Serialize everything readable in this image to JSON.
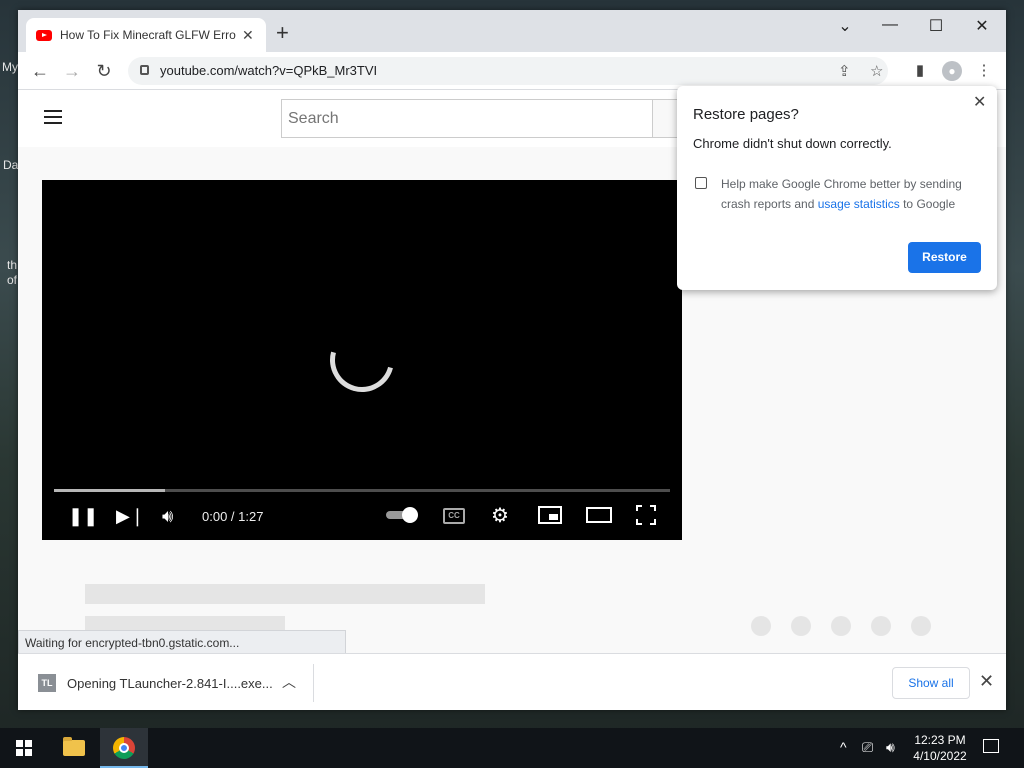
{
  "desktop": {
    "fragments": [
      "My",
      "Da",
      "th",
      "of"
    ]
  },
  "browser": {
    "tab_title": "How To Fix Minecraft GLFW Error",
    "tab_close": "✕",
    "new_tab": "+",
    "window_controls": {
      "tab_search": "⌄",
      "minimize": "—",
      "maximize": "☐",
      "close": "✕"
    },
    "nav": {
      "back": "←",
      "forward": "→",
      "reload": "↻"
    },
    "url": "youtube.com/watch?v=QPkB_Mr3TVI",
    "omnibox_icons": [
      "share-icon",
      "star-icon"
    ],
    "toolbar_icons": [
      "side-panel-icon",
      "profile-icon",
      "menu-icon"
    ]
  },
  "youtube": {
    "search_placeholder": "Search",
    "player": {
      "time": "0:00 / 1:27",
      "progress_fraction": 0.18,
      "controls": [
        "pause-icon",
        "next-icon",
        "volume-icon",
        "autoplay-toggle",
        "captions-icon",
        "settings-icon",
        "miniplayer-icon",
        "theater-icon",
        "fullscreen-icon"
      ]
    }
  },
  "status_bar": {
    "text": "Waiting for encrypted-tbn0.gstatic.com..."
  },
  "download_bar": {
    "icon_label": "TL",
    "item_text": "Opening TLauncher-2.841-I....exe...",
    "show_all": "Show all",
    "close": "✕"
  },
  "restore_popup": {
    "title": "Restore pages?",
    "message": "Chrome didn't shut down correctly.",
    "help_text_before": "Help make Google Chrome better by sending crash reports and ",
    "help_link": "usage statistics",
    "help_text_after": " to Google",
    "button": "Restore",
    "checkbox_checked": false,
    "close": "✕"
  },
  "taskbar": {
    "time": "12:23 PM",
    "date": "4/10/2022",
    "tray_chevron": "^"
  },
  "colors": {
    "accent": "#1a73e8",
    "youtube_red": "#ff0000",
    "tab_strip": "#dee1e6"
  }
}
